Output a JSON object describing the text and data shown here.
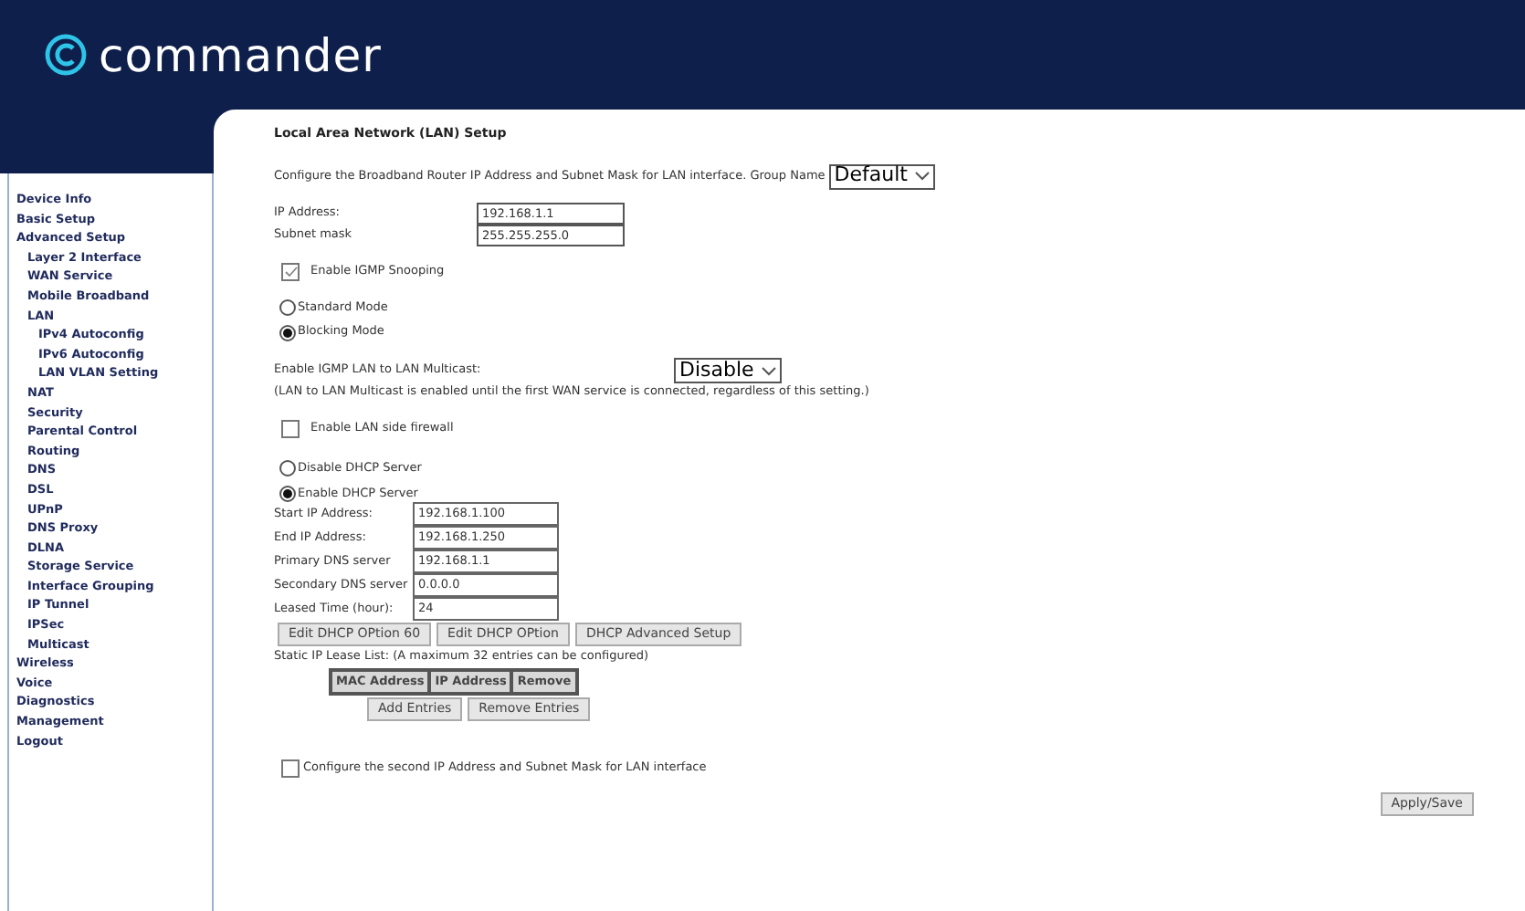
{
  "brand": {
    "name": "commander"
  },
  "sidebar": {
    "items": [
      {
        "label": "Device Info"
      },
      {
        "label": "Basic Setup"
      },
      {
        "label": "Advanced Setup",
        "children": [
          {
            "label": "Layer 2 Interface"
          },
          {
            "label": "WAN Service"
          },
          {
            "label": "Mobile Broadband"
          },
          {
            "label": "LAN",
            "children": [
              {
                "label": "IPv4 Autoconfig"
              },
              {
                "label": "IPv6 Autoconfig"
              },
              {
                "label": "LAN VLAN Setting"
              }
            ]
          },
          {
            "label": "NAT"
          },
          {
            "label": "Security"
          },
          {
            "label": "Parental Control"
          },
          {
            "label": "Routing"
          },
          {
            "label": "DNS"
          },
          {
            "label": "DSL"
          },
          {
            "label": "UPnP"
          },
          {
            "label": "DNS Proxy"
          },
          {
            "label": "DLNA"
          },
          {
            "label": "Storage Service"
          },
          {
            "label": "Interface Grouping"
          },
          {
            "label": "IP Tunnel"
          },
          {
            "label": "IPSec"
          },
          {
            "label": "Multicast"
          }
        ]
      },
      {
        "label": "Wireless"
      },
      {
        "label": "Voice"
      },
      {
        "label": "Diagnostics"
      },
      {
        "label": "Management"
      },
      {
        "label": "Logout"
      }
    ]
  },
  "page": {
    "title": "Local Area Network (LAN) Setup",
    "intro": "Configure the Broadband Router IP Address and Subnet Mask for LAN interface. Group Name",
    "group_select": {
      "value": "Default"
    },
    "lan_fields": [
      {
        "label": "IP Address:",
        "value": "192.168.1.1"
      },
      {
        "label": "Subnet mask",
        "value": "255.255.255.0"
      }
    ],
    "igmp_snooping": {
      "label": "Enable IGMP Snooping",
      "checked": true
    },
    "igmp_modes": [
      {
        "label": "Standard Mode",
        "selected": false
      },
      {
        "label": "Blocking Mode",
        "selected": true
      }
    ],
    "multicast": {
      "label": "Enable IGMP LAN to LAN Multicast:",
      "value": "Disable",
      "note": "(LAN to LAN Multicast is enabled until the first WAN service is connected, regardless of this setting.)"
    },
    "firewall": {
      "label": "Enable LAN side firewall",
      "checked": false
    },
    "dhcp_modes": [
      {
        "label": "Disable DHCP Server",
        "selected": false
      },
      {
        "label": "Enable DHCP Server",
        "selected": true
      }
    ],
    "dhcp_fields": [
      {
        "label": "Start IP Address:",
        "value": "192.168.1.100"
      },
      {
        "label": "End IP Address:",
        "value": "192.168.1.250"
      },
      {
        "label": "Primary DNS server",
        "value": "192.168.1.1"
      },
      {
        "label": "Secondary DNS server",
        "value": "0.0.0.0"
      },
      {
        "label": "Leased Time (hour):",
        "value": "24"
      }
    ],
    "dhcp_buttons": [
      "Edit DHCP OPtion 60",
      "Edit DHCP OPtion",
      "DHCP Advanced Setup"
    ],
    "lease_note": "Static IP Lease List: (A maximum 32 entries can be configured)",
    "lease_columns": [
      "MAC Address",
      "IP Address",
      "Remove"
    ],
    "lease_buttons": [
      "Add Entries",
      "Remove Entries"
    ],
    "second_ip": {
      "label": "Configure the second IP Address and Subnet Mask for LAN interface",
      "checked": false
    },
    "apply_button": "Apply/Save"
  }
}
